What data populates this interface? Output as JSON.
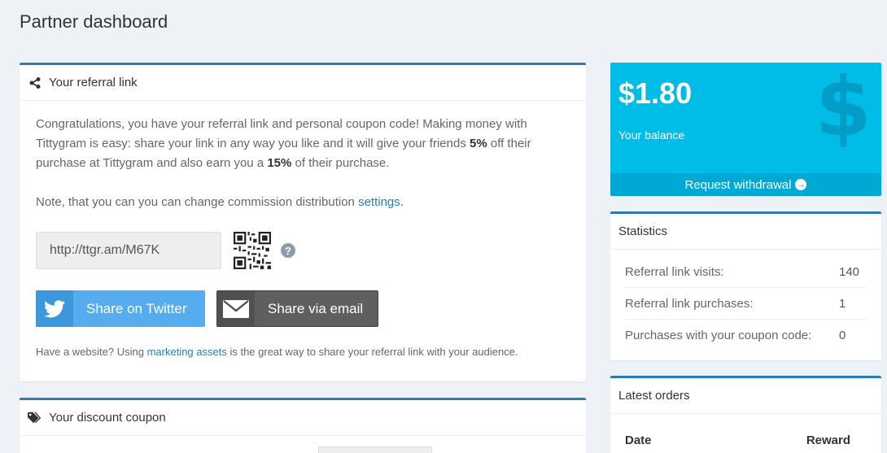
{
  "page": {
    "title": "Partner dashboard"
  },
  "referral": {
    "title": "Your referral link",
    "intro_1": "Congratulations, you have your referral link and personal coupon code! Making money with Tittygram is easy: share your link in any way you like and it will give your friends ",
    "discount": "5%",
    "intro_2": " off their purchase at Tittygram and also earn you a ",
    "commission": "15%",
    "intro_3": " of their purchase.",
    "note_text": "Note, that you can you can change commission distribution ",
    "note_link": "settings",
    "note_end": ".",
    "link_value": "http://ttgr.am/M67K",
    "help_glyph": "?",
    "twitter_label": "Share on Twitter",
    "email_label": "Share via email",
    "small_text": "Have a website? Using ",
    "small_link": "marketing assets",
    "small_end": " is the great way to share your referral link with your audience."
  },
  "coupon": {
    "title": "Your discount coupon"
  },
  "balance": {
    "amount": "$1.80",
    "label": "Your balance",
    "symbol": "$",
    "withdraw_label": "Request withdrawal",
    "withdraw_icon": "→"
  },
  "statistics": {
    "title": "Statistics",
    "rows": [
      {
        "label": "Referral link visits:",
        "value": "140"
      },
      {
        "label": "Referral link purchases:",
        "value": "1"
      },
      {
        "label": "Purchases with your coupon code:",
        "value": "0"
      }
    ]
  },
  "orders": {
    "title": "Latest orders",
    "columns": [
      "Date",
      "Reward"
    ]
  },
  "icons": {
    "share": "share-icon",
    "tags": "tags-icon",
    "twitter": "twitter-icon",
    "email": "envelope-icon",
    "qr": "qr-code-icon",
    "help": "help-icon"
  },
  "colors": {
    "accent": "#2a7db1",
    "balance_bg": "#00bde8",
    "twitter": "#55acee",
    "email_btn": "#5f5f5f"
  }
}
